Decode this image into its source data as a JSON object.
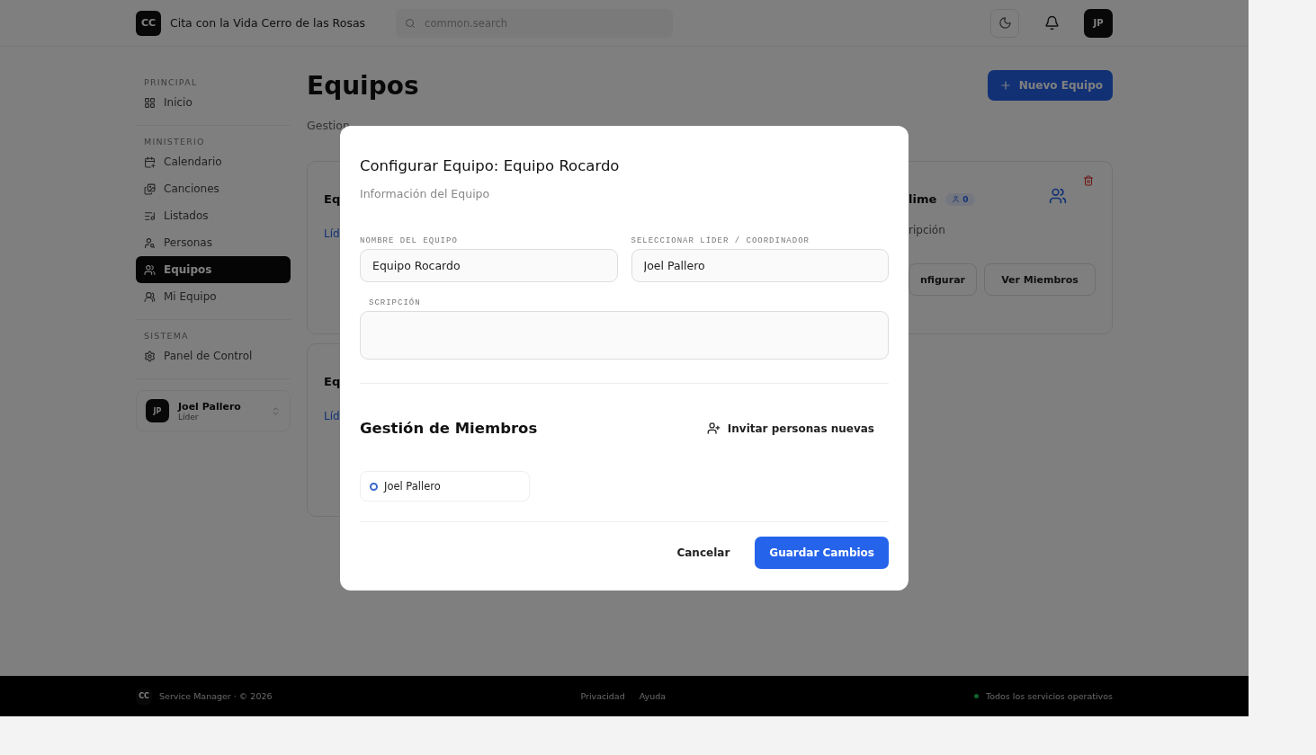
{
  "header": {
    "logo": "CC",
    "org": "Cita con la Vida Cerro de las Rosas",
    "search": {
      "placeholder": "common.search"
    },
    "avatar": "JP"
  },
  "sidebar": {
    "sections": [
      {
        "label": "PRINCIPAL",
        "items": [
          {
            "label": "Inicio",
            "selected": false
          }
        ]
      },
      {
        "label": "MINISTERIO",
        "items": [
          {
            "label": "Calendario",
            "selected": false
          },
          {
            "label": "Canciones",
            "selected": false
          },
          {
            "label": "Listados",
            "selected": false
          },
          {
            "label": "Personas",
            "selected": false
          },
          {
            "label": "Equipos",
            "selected": true
          },
          {
            "label": "Mi Equipo",
            "selected": false
          }
        ]
      },
      {
        "label": "SISTEMA",
        "items": [
          {
            "label": "Panel de Control",
            "selected": false
          }
        ]
      }
    ],
    "user": {
      "initials": "JP",
      "name": "Joel Pallero",
      "role": "Líder"
    }
  },
  "page": {
    "title": "Equipos",
    "subtitle": "Gestion",
    "new_button": "Nuevo Equipo",
    "cards": [
      {
        "kind": "left",
        "title": "Eq",
        "leader": "Líd"
      },
      {
        "kind": "right",
        "title": "lime",
        "count": "0",
        "description": "ripción",
        "buttons": [
          "nfigurar",
          "Ver Miembros"
        ]
      },
      {
        "kind": "left",
        "title": "Eq",
        "leader": "Líd"
      }
    ]
  },
  "footer": {
    "logo": "CC",
    "brand": "Service Manager · © 2026",
    "links": [
      "Privacidad",
      "Ayuda"
    ],
    "status": "Todos los servicios operativos"
  },
  "dialog": {
    "title": "Configurar Equipo: Equipo Rocardo",
    "subtitle": "Información del Equipo",
    "fields": [
      {
        "label": "NOMBRE DEL EQUIPO",
        "value": "Equipo Rocardo"
      },
      {
        "label": "SELECCIONAR LÍDER / COORDINADOR",
        "value": "Joel Pallero"
      }
    ],
    "description_label": "SCRIPCIÓN",
    "members_title": "Gestión de Miembros",
    "invite": "Invitar personas nuevas",
    "members": [
      "Joel Pallero"
    ],
    "cancel": "Cancelar",
    "save": "Guardar Cambios"
  }
}
